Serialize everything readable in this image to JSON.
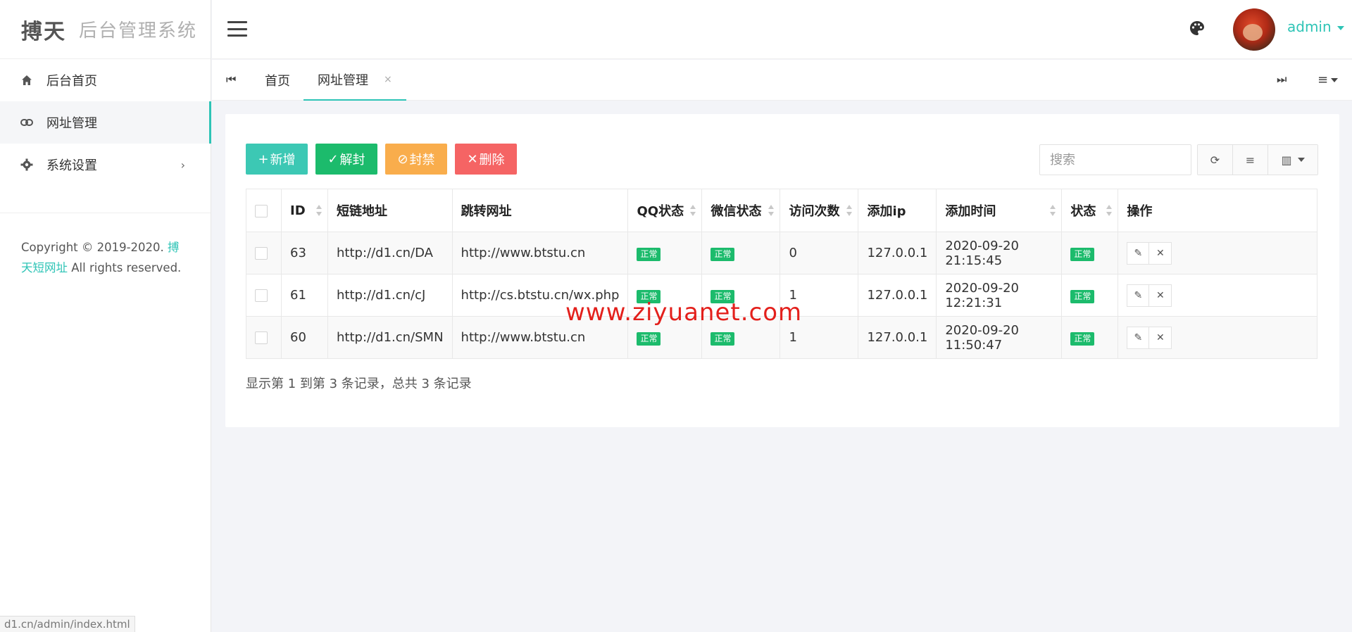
{
  "app": {
    "brand": "搏天",
    "subtitle": "后台管理系统",
    "user": "admin"
  },
  "sidebar": {
    "items": [
      {
        "label": "后台首页",
        "icon": "home-icon"
      },
      {
        "label": "网址管理",
        "icon": "link-icon"
      },
      {
        "label": "系统设置",
        "icon": "gear-icon"
      }
    ],
    "copyright_prefix": "Copyright © 2019-2020.",
    "copyright_link": "搏天短网址",
    "copyright_suffix": "All rights reserved."
  },
  "tabs": {
    "home": "首页",
    "current": "网址管理",
    "close": "×"
  },
  "toolbar": {
    "add": "新增",
    "unban": "解封",
    "ban": "封禁",
    "delete": "删除",
    "search_placeholder": "搜索"
  },
  "table": {
    "headers": {
      "id": "ID",
      "short": "短链地址",
      "target": "跳转网址",
      "qq": "QQ状态",
      "wechat": "微信状态",
      "visits": "访问次数",
      "ip": "添加ip",
      "time": "添加时间",
      "status": "状态",
      "ops": "操作"
    },
    "rows": [
      {
        "id": "63",
        "short": "http://d1.cn/DA",
        "target": "http://www.btstu.cn",
        "qq": "正常",
        "wechat": "正常",
        "visits": "0",
        "ip": "127.0.0.1",
        "time": "2020-09-20 21:15:45",
        "status": "正常"
      },
      {
        "id": "61",
        "short": "http://d1.cn/cJ",
        "target": "http://cs.btstu.cn/wx.php",
        "qq": "正常",
        "wechat": "正常",
        "visits": "1",
        "ip": "127.0.0.1",
        "time": "2020-09-20 12:21:31",
        "status": "正常"
      },
      {
        "id": "60",
        "short": "http://d1.cn/SMN",
        "target": "http://www.btstu.cn",
        "qq": "正常",
        "wechat": "正常",
        "visits": "1",
        "ip": "127.0.0.1",
        "time": "2020-09-20 11:50:47",
        "status": "正常"
      }
    ],
    "summary": "显示第 1 到第 3 条记录，总共 3 条记录"
  },
  "watermark": "www.ziyuanet.com",
  "status_bar_url": "d1.cn/admin/index.html",
  "colors": {
    "accent": "#2ec4b6",
    "add": "#3cc8b4",
    "unban": "#1cbb6c",
    "ban": "#f9ad4c",
    "delete": "#f56464",
    "badge": "#1cbb6c"
  }
}
